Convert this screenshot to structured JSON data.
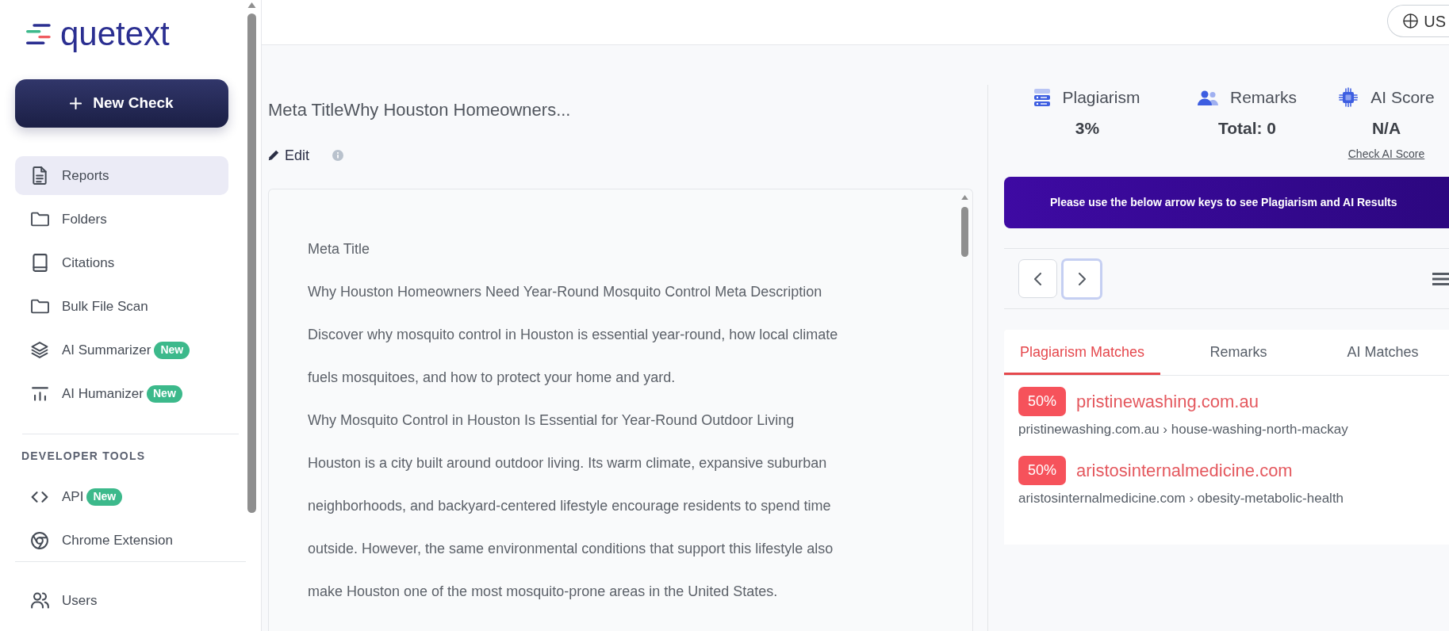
{
  "sidebar": {
    "logo": "quetext",
    "new_check_button": "New Check",
    "groups": [
      {
        "items": [
          {
            "label": "Reports",
            "selected": true
          },
          {
            "label": "Folders",
            "selected": false
          },
          {
            "label": "Citations",
            "selected": false
          },
          {
            "label": "Bulk File Scan",
            "selected": false
          },
          {
            "label": "AI Summarizer",
            "selected": false,
            "badge": "New"
          },
          {
            "label": "AI Humanizer",
            "selected": false,
            "badge": "New"
          }
        ]
      },
      {
        "heading": "DEVELOPER TOOLS",
        "items": [
          {
            "label": "API",
            "selected": false,
            "badge": "New"
          },
          {
            "label": "Chrome Extension",
            "selected": false
          }
        ]
      },
      {
        "items": [
          {
            "label": "Users",
            "selected": false
          }
        ]
      }
    ]
  },
  "top_bar": {
    "language_button": "US"
  },
  "document": {
    "title": "Meta TitleWhy Houston Homeowners...",
    "edit_button": "Edit",
    "paragraphs": [
      {
        "lines": [
          "Meta Title"
        ]
      },
      {
        "lines": [
          "Why Houston Homeowners Need Year-Round Mosquito Control Meta Description"
        ]
      },
      {
        "lines": [
          "Discover why mosquito control in Houston is essential year-round, how local climate",
          "fuels mosquitoes, and how to protect your home and yard."
        ]
      },
      {
        "lines": [
          "Why Mosquito Control in Houston Is Essential for Year-Round Outdoor Living"
        ]
      },
      {
        "lines": [
          "Houston is a city built around outdoor living. Its warm climate, expansive suburban",
          "neighborhoods, and backyard-centered lifestyle encourage residents to spend time",
          "outside. However, the same environmental conditions that support this lifestyle also",
          "make Houston one of the most mosquito-prone areas in the United States."
        ]
      }
    ]
  },
  "results": {
    "stats": [
      {
        "label": "Plagiarism",
        "value": "3%"
      },
      {
        "label": "Remarks",
        "value": "Total: 0"
      },
      {
        "label": "AI Score",
        "value": "N/A",
        "link": "Check AI Score"
      }
    ],
    "banner": "Please use the below arrow keys to see Plagiarism and AI Results",
    "nav_buttons": [
      {
        "kind": "prev",
        "focused": false
      },
      {
        "kind": "next",
        "focused": true
      }
    ],
    "tabs": [
      {
        "label": "Plagiarism Matches",
        "selected": true
      },
      {
        "label": "Remarks",
        "selected": false
      },
      {
        "label": "AI Matches",
        "selected": false
      }
    ],
    "matches": [
      {
        "percent": "50%",
        "site": "pristinewashing.com.au",
        "breadcrumb": "pristinewashing.com.au › house-washing-north-mackay"
      },
      {
        "percent": "50%",
        "site": "aristosinternalmedicine.com",
        "breadcrumb": "aristosinternalmedicine.com › obesity-metabolic-health"
      }
    ]
  }
}
